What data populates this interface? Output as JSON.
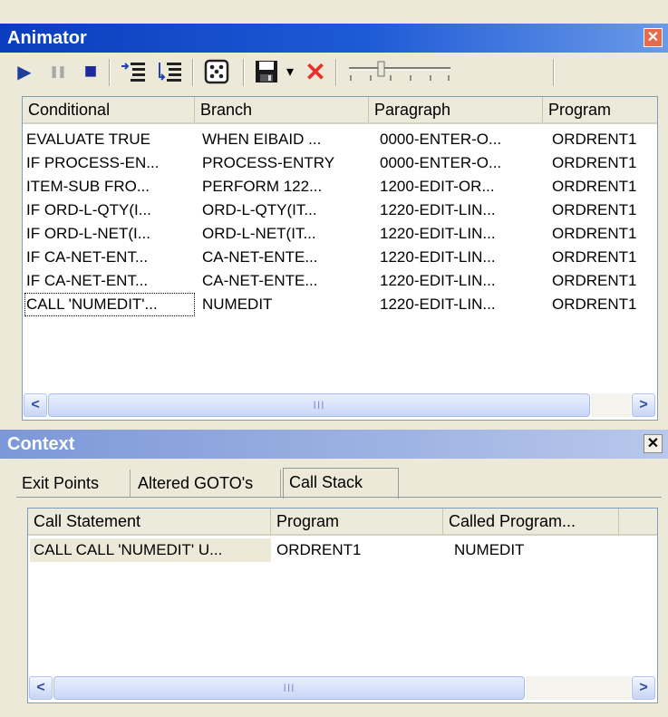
{
  "animator": {
    "title": "Animator",
    "toolbar": [
      {
        "name": "play-icon",
        "glyph": "▶"
      },
      {
        "name": "pause-icon",
        "glyph": "❚❚"
      },
      {
        "name": "stop-icon",
        "glyph": "■"
      },
      {
        "name": "step-into-icon",
        "glyph": "⇥"
      },
      {
        "name": "step-over-icon",
        "glyph": "↲"
      },
      {
        "name": "dice-icon",
        "glyph": "⚄"
      },
      {
        "name": "save-icon",
        "glyph": "▣"
      },
      {
        "name": "dropdown-arrow-icon",
        "glyph": "▾"
      },
      {
        "name": "delete-icon",
        "glyph": "✕"
      }
    ],
    "columns": [
      "Conditional",
      "Branch",
      "Paragraph",
      "Program"
    ],
    "rows": [
      [
        "EVALUATE TRUE",
        "WHEN EIBAID ...",
        "0000-ENTER-O...",
        "ORDRENT1"
      ],
      [
        "IF PROCESS-EN...",
        "PROCESS-ENTRY",
        "0000-ENTER-O...",
        "ORDRENT1"
      ],
      [
        "ITEM-SUB FRO...",
        "PERFORM 122...",
        "1200-EDIT-OR...",
        "ORDRENT1"
      ],
      [
        "IF ORD-L-QTY(I...",
        "ORD-L-QTY(IT...",
        "1220-EDIT-LIN...",
        "ORDRENT1"
      ],
      [
        "IF ORD-L-NET(I...",
        "ORD-L-NET(IT...",
        "1220-EDIT-LIN...",
        "ORDRENT1"
      ],
      [
        "IF CA-NET-ENT...",
        "CA-NET-ENTE...",
        "1220-EDIT-LIN...",
        "ORDRENT1"
      ],
      [
        "IF CA-NET-ENT...",
        "CA-NET-ENTE...",
        "1220-EDIT-LIN...",
        "ORDRENT1"
      ],
      [
        "CALL 'NUMEDIT'...",
        "NUMEDIT",
        "1220-EDIT-LIN...",
        "ORDRENT1"
      ]
    ],
    "focused_row": 7
  },
  "context": {
    "title": "Context",
    "tabs": [
      "Exit Points",
      "Altered GOTO's",
      "Call Stack"
    ],
    "active_tab": 2,
    "columns": [
      "Call Statement",
      "Program",
      "Called Program..."
    ],
    "rows": [
      [
        "CALL CALL 'NUMEDIT' U...",
        "ORDRENT1",
        "NUMEDIT"
      ]
    ]
  },
  "scroll_grip": "III",
  "close_glyph": "✕",
  "colors": {
    "title_active": "#0a3dbd",
    "title_inactive": "#7c98d8",
    "selection": "#ece9d8",
    "delete": "#e8302a"
  }
}
